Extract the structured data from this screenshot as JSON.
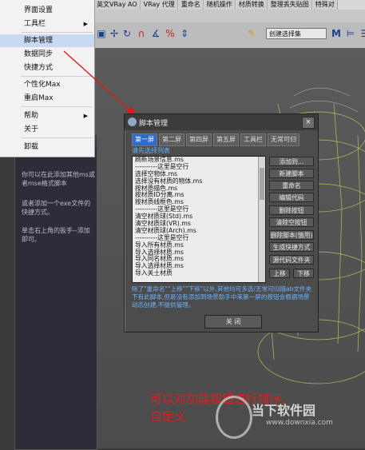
{
  "top_tabs": [
    "英文VRay AO",
    "VRay 代理",
    "重命名",
    "随机操作",
    "材质转换",
    "整理丢失贴图",
    "特殊对"
  ],
  "toolbar": {
    "selection_set": "创建选择集"
  },
  "menu": {
    "items": [
      {
        "label": "界面设置"
      },
      {
        "label": "工具栏",
        "arrow": true
      },
      {
        "label": "脚本管理",
        "active": true
      },
      {
        "label": "数据同步"
      },
      {
        "label": "快捷方式"
      },
      {
        "label": "个性化Max"
      },
      {
        "label": "重启Max"
      },
      {
        "label": "帮助",
        "arrow": true
      },
      {
        "label": "关于"
      },
      {
        "label": "卸载"
      }
    ]
  },
  "left_panel": {
    "p1": "你可以在此添加其他ms或者mse格式脚本",
    "p2": "或者添加一个exe文件的快捷方式。",
    "p3": "单击右上角的扳手--添加即可。"
  },
  "dialog": {
    "title": "脚本管理",
    "close": "×",
    "tabs": [
      "第一屏",
      "第二屏",
      "第四屏",
      "第五屏",
      "工具栏",
      "无常可归"
    ],
    "hint": "请先选择列表",
    "list": [
      "刷新场景信息.ms",
      "----------这里是空行",
      "选择空物体.ms",
      "选择没有材质的物体.ms",
      "按材质描色.ms",
      "按材质ID分离.ms",
      "按材质线框色.ms",
      "----------这里是空行",
      "清空材质球(Std).ms",
      "清空材质球(VR).ms",
      "清空材质球(Arch).ms",
      "----------这里是空行",
      "导入所有材质.ms",
      "导入选择材质.ms",
      "导入同名材质.ms",
      "导入选择材质.ms",
      "导入关土材质"
    ],
    "buttons": [
      "添加到...",
      "新建脚本",
      "重命名",
      "编辑代码",
      "删除按钮",
      "清除空按钮",
      "删除脚本(慎用)",
      "生成快捷方式",
      "源代码文件夹"
    ],
    "move_up": "上移",
    "move_down": "下移",
    "note": "除了\"重命名\"\"上移\"\"下移\"以外,其他均可多选/无常可归描ab文件夹下有此脚本,但是没有添加到场景助手中来第一屏的按钮会根据场景动态创建,不提供管理。",
    "close_button": "关 闭"
  },
  "caption": {
    "line1": "可以对功能按钮进行排序,",
    "line2": "自定义"
  },
  "watermark": {
    "name": "当下软件园",
    "url": "www.downxia.com"
  },
  "colors": {
    "accent": "#2f6bc8",
    "hint": "#6ab4ff",
    "caption": "#e02020"
  }
}
